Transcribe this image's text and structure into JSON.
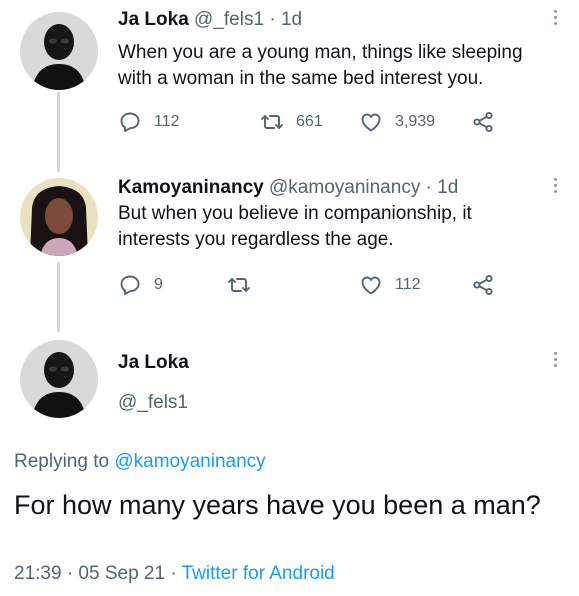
{
  "tweets": [
    {
      "name": "Ja Loka",
      "handle": "@_fels1",
      "separator": "·",
      "time": "1d",
      "text": "When you are a young man, things like sleeping with a woman in the same bed interest you.",
      "replies": "112",
      "retweets": "661",
      "likes": "3,939"
    },
    {
      "name": "Kamoyaninancy",
      "handle": "@kamoyaninancy",
      "separator": "·",
      "time": "1d",
      "text": "But when you believe in companionship, it interests you regardless the age.",
      "replies": "9",
      "retweets": "",
      "likes": "112"
    }
  ],
  "focal": {
    "name": "Ja Loka",
    "handle": "@_fels1",
    "replying_prefix": "Replying to",
    "replying_to": "@kamoyaninancy",
    "text": "For how many years have you been a man?",
    "date": "21:39 · 05 Sep 21",
    "separator": "·",
    "source": "Twitter for Android"
  },
  "icons": {
    "reply": "reply-icon",
    "retweet": "retweet-icon",
    "like": "heart-icon",
    "share": "share-icon",
    "more": "more-vertical-icon"
  },
  "colors": {
    "text": "#0f1419",
    "secondary": "#536471",
    "accent": "#1d9bf0",
    "thread_line": "#cfd9de"
  }
}
